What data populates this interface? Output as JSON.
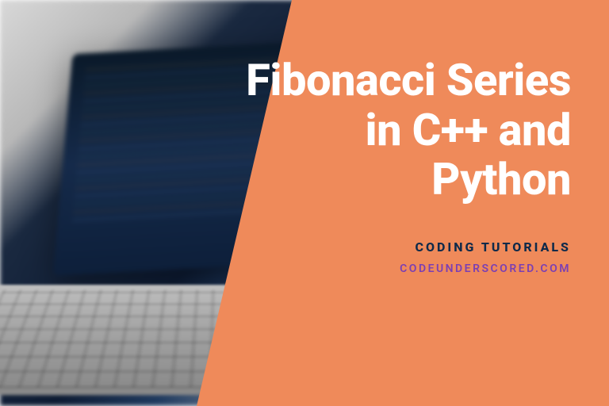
{
  "title": "Fibonacci Series in C++ and Python",
  "subtitle": "CODING TUTORIALS",
  "website": "CODEUNDERSCORED.COM",
  "colors": {
    "overlay": "#ef8a5a",
    "title": "#ffffff",
    "subtitle": "#0f2a4a",
    "website": "#7b3fb3"
  }
}
